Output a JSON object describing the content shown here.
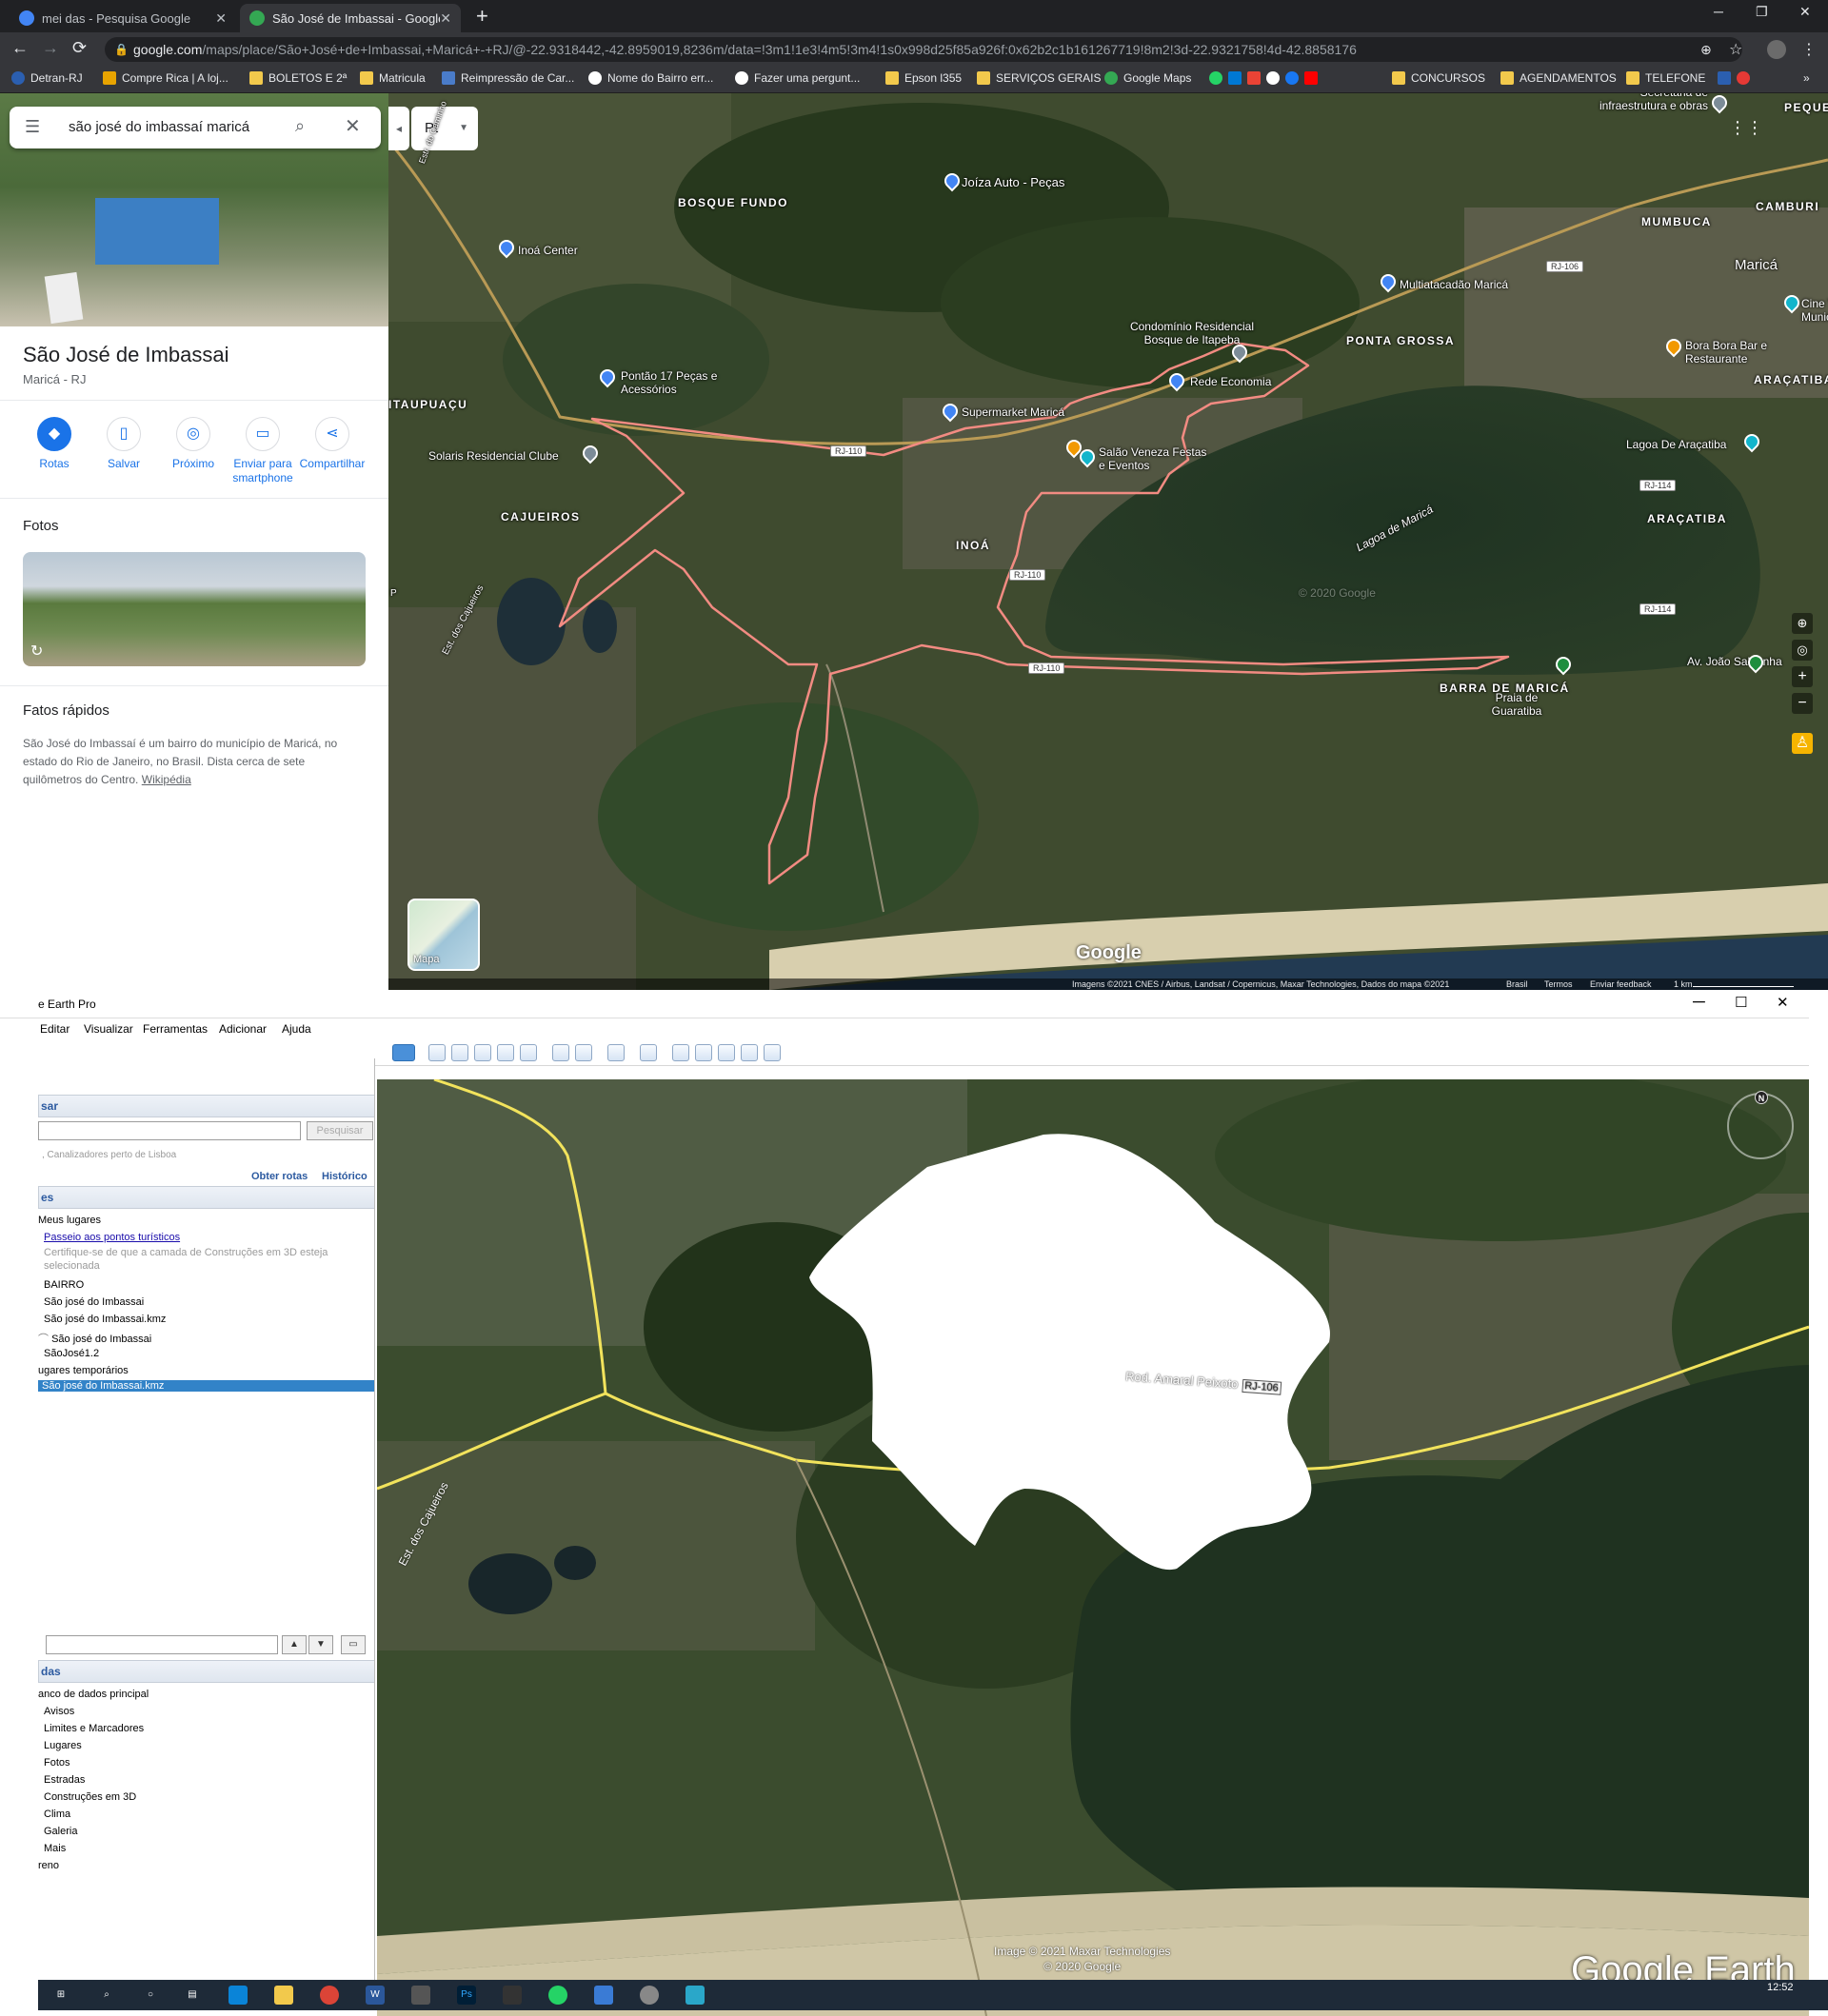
{
  "browser": {
    "tabs": [
      {
        "title": "mei das - Pesquisa Google",
        "active": false
      },
      {
        "title": "São José de Imbassai - Google M",
        "active": true
      }
    ],
    "new_tab": "+",
    "window_controls": [
      "─",
      "❐",
      "✕"
    ],
    "nav": [
      "←",
      "→",
      "⟳"
    ],
    "url_host": "google.com",
    "url_path": "/maps/place/São+José+de+Imbassai,+Maricá+-+RJ/@-22.9318442,-42.8959019,8236m/data=!3m1!1e3!4m5!3m4!1s0x998d25f85a926f:0x62b2c1b161267719!8m2!3d-22.9321758!4d-42.8858176",
    "bookmarks": [
      {
        "label": "Detran-RJ",
        "icon": "detran-icon"
      },
      {
        "label": "Compre Rica | A loj...",
        "icon": "shop-icon"
      },
      {
        "label": "BOLETOS E 2ª",
        "icon": "folder-icon"
      },
      {
        "label": "Matricula",
        "icon": "folder-icon"
      },
      {
        "label": "Reimpressão de Car...",
        "icon": "page-icon"
      },
      {
        "label": "Nome do Bairro err...",
        "icon": "google-icon"
      },
      {
        "label": "Fazer uma pergunt...",
        "icon": "google-icon"
      },
      {
        "label": "Epson l355",
        "icon": "folder-icon"
      },
      {
        "label": "SERVIÇOS GERAIS",
        "icon": "folder-icon"
      },
      {
        "label": "Google Maps",
        "icon": "maps-icon"
      },
      {
        "label": "CONCURSOS",
        "icon": "folder-icon"
      },
      {
        "label": "AGENDAMENTOS",
        "icon": "folder-icon"
      },
      {
        "label": "TELEFONE",
        "icon": "folder-icon"
      }
    ]
  },
  "maps": {
    "search_query": "são josé do imbassaí maricá",
    "place_title": "São José de Imbassai",
    "place_subtitle": "Maricá - RJ",
    "actions": [
      {
        "label": "Rotas",
        "icon": "directions-icon"
      },
      {
        "label": "Salvar",
        "icon": "bookmark-icon"
      },
      {
        "label": "Próximo",
        "icon": "nearby-icon"
      },
      {
        "label": "Enviar para smartphone",
        "icon": "phone-icon"
      },
      {
        "label": "Compartilhar",
        "icon": "share-icon"
      }
    ],
    "photos_heading": "Fotos",
    "quick_facts_heading": "Fatos rápidos",
    "quick_facts_text": "São José do Imbassaí é um bairro do município de Maricá, no estado do Rio de Janeiro, no Brasil. Dista cerca de sete quilômetros do Centro.",
    "quick_facts_link": "Wikipédia",
    "lang_button": "Pt",
    "layer_label": "Mapa",
    "logo": "Google",
    "area_labels": [
      "BOSQUE FUNDO",
      "ITAUPUAÇU",
      "CAJUEIROS",
      "INOÁ",
      "PONTA GROSSA",
      "MUMBUCA",
      "CAMBURI",
      "ARAÇATIBA",
      "ARAÇATIBA",
      "BARRA DE MARICÁ",
      "Maricá",
      "PEQUENO"
    ],
    "poi_labels": [
      "Joíza Auto - Peças",
      "Inoá Center",
      "Multiatacadão Maricá",
      "Condomínio Residencial Bosque de Itapeba",
      "Pontão 17 Peças e Acessórios",
      "Rede Economia",
      "Supermarket Maricá",
      "Solaris Residencial Clube",
      "Salão Veneza Festas e Eventos",
      "Bora Bora Bar e Restaurante",
      "Lagoa De Araçatiba",
      "Secretaria de infraestrutura e obras",
      "Praia de Guaratiba",
      "Lagoa de Maricá",
      "Av. João Saldanha",
      "Cine T Munic",
      "Est. dos Cajueiros",
      "Estr. do Caminho",
      "P"
    ],
    "road_shields": [
      "RJ-106",
      "RJ-110",
      "RJ-110",
      "RJ-110",
      "RJ-114",
      "RJ-114"
    ],
    "watermarks": [
      "© 2020 Google"
    ],
    "footer": {
      "imagery": "Imagens ©2021 CNES / Airbus, Landsat / Copernicus, Maxar Technologies, Dados do mapa ©2021",
      "country": "Brasil",
      "terms": "Termos",
      "feedback": "Enviar feedback",
      "scale": "1 km"
    }
  },
  "earth": {
    "window_title": "e Earth Pro",
    "window_controls": [
      "─",
      "☐",
      "✕"
    ],
    "menu": [
      "Editar",
      "Visualizar",
      "Ferramentas",
      "Adicionar",
      "Ajuda"
    ],
    "search_header": "sar",
    "search_button": "Pesquisar",
    "search_hint": ", Canalizadores perto de Lisboa",
    "get_routes": "Obter rotas",
    "history": "Histórico",
    "places_header": "es",
    "tree": [
      {
        "label": "Meus lugares",
        "style": "normal"
      },
      {
        "label": "Passeio aos pontos turísticos",
        "style": "link"
      },
      {
        "label": "Certifique-se de que a camada de Construções em 3D esteja",
        "style": "grey"
      },
      {
        "label": "selecionada",
        "style": "grey"
      },
      {
        "label": "BAIRRO",
        "style": "normal"
      },
      {
        "label": "São josé do Imbassai",
        "style": "normal"
      },
      {
        "label": "São josé do Imbassai.kmz",
        "style": "normal"
      },
      {
        "label": "São josé do Imbassai",
        "style": "normal"
      },
      {
        "label": "SãoJosé1.2",
        "style": "normal"
      },
      {
        "label": "ugares temporários",
        "style": "normal"
      },
      {
        "label": "São josé do Imbassai.kmz",
        "style": "selected"
      }
    ],
    "layers_header": "das",
    "layers": [
      "anco de dados principal",
      "Avisos",
      "Limites e Marcadores",
      "Lugares",
      "Fotos",
      "Estradas",
      "Construções em 3D",
      "Clima",
      "Galeria",
      "Mais",
      "reno"
    ],
    "road_name": "Rod. Amaral Peixoto",
    "road_shield": "RJ-106",
    "road_label_2": "Est. dos Cajueiros",
    "compass_n": "N",
    "credit_1": "Image © 2021 Maxar Technologies",
    "credit_2": "© 2020 Google",
    "brand": "Google Earth",
    "taskbar_time": "12:52"
  },
  "colors": {
    "boundary": "#f28b82",
    "road_yellow": "#f2e35c",
    "earth_white_patch": "#ffffff",
    "selection_blue": "#3283c8"
  }
}
